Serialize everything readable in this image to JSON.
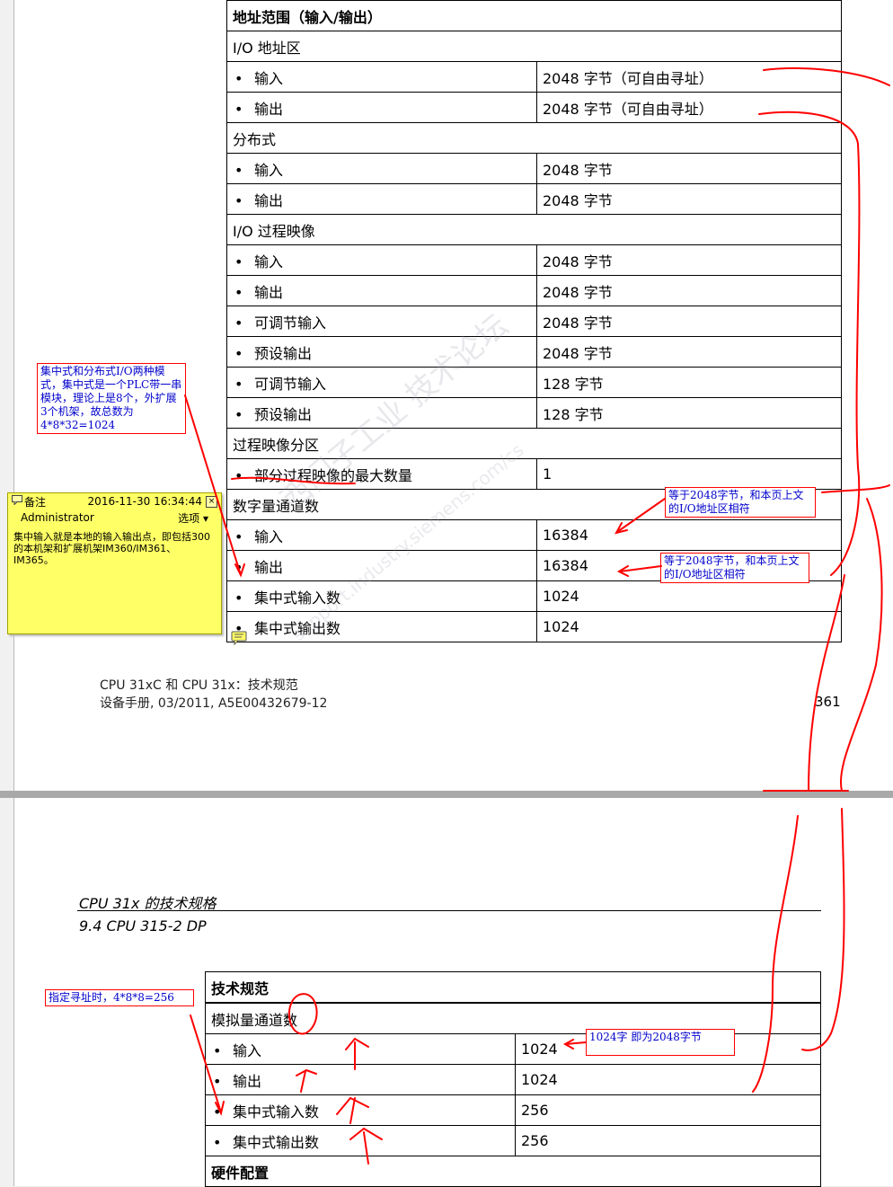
{
  "page1": {
    "table": {
      "header": "地址范围（输入/输出）",
      "rows": [
        {
          "type": "section",
          "label": "I/O 地址区"
        },
        {
          "type": "item",
          "label": "输入",
          "value": "2048 字节（可自由寻址）"
        },
        {
          "type": "item",
          "label": "输出",
          "value": "2048 字节（可自由寻址）"
        },
        {
          "type": "section",
          "label": "分布式"
        },
        {
          "type": "item",
          "label": "输入",
          "value": "2048 字节"
        },
        {
          "type": "item",
          "label": "输出",
          "value": "2048 字节"
        },
        {
          "type": "section",
          "label": "I/O 过程映像"
        },
        {
          "type": "item",
          "label": "输入",
          "value": "2048 字节"
        },
        {
          "type": "item",
          "label": "输出",
          "value": "2048 字节"
        },
        {
          "type": "item",
          "label": "可调节输入",
          "value": "2048 字节"
        },
        {
          "type": "item",
          "label": "预设输出",
          "value": "2048 字节"
        },
        {
          "type": "item",
          "label": "可调节输入",
          "value": "128 字节"
        },
        {
          "type": "item",
          "label": "预设输出",
          "value": "128 字节"
        },
        {
          "type": "section",
          "label": "过程映像分区"
        },
        {
          "type": "item",
          "label": "部分过程映像的最大数量",
          "value": "1"
        },
        {
          "type": "section",
          "label": "数字量通道数"
        },
        {
          "type": "item",
          "label": "输入",
          "value": "16384"
        },
        {
          "type": "item",
          "label": "输出",
          "value": "16384"
        },
        {
          "type": "item",
          "label": "集中式输入数",
          "value": "1024"
        },
        {
          "type": "item",
          "label": "集中式输出数",
          "value": "1024"
        }
      ]
    },
    "footer_line1": "CPU 31xC 和 CPU 31x：技术规范",
    "footer_line2": "设备手册, 03/2011, A5E00432679-12",
    "page_number": "361"
  },
  "page2": {
    "chapter": "CPU 31x 的技术规格",
    "section": "9.4 CPU 315-2 DP",
    "table": {
      "header": "技术规范",
      "rows": [
        {
          "type": "section",
          "label": "模拟量通道数"
        },
        {
          "type": "item",
          "label": "输入",
          "value": "1024"
        },
        {
          "type": "item",
          "label": "输出",
          "value": "1024"
        },
        {
          "type": "item",
          "label": "集中式输入数",
          "value": "256"
        },
        {
          "type": "item",
          "label": "集中式输出数",
          "value": "256"
        }
      ],
      "footer_header": "硬件配置"
    }
  },
  "annotations": {
    "note_left": "集中式和分布式I/O两种模式，集中式是一个PLC带一串模块，理论上是8个，外扩展3个机架，故总数为4*8*32=1024",
    "note_digital_in": "等于2048字节，和本页上文的I/O地址区相符",
    "note_digital_out": "等于2048字节，和本页上文的I/O地址区相符",
    "note_addr": "指定寻址时，4*8*8=256",
    "note_analog": "1024字   即为2048字节"
  },
  "sticky_note": {
    "title": "备注",
    "timestamp": "2016-11-30 16:34:44",
    "author": "Administrator",
    "options": "选项",
    "body": "集中输入就是本地的输入输出点，即包括300的本机架和扩展机架IM360/IM361、IM365。"
  },
  "watermark": "西门子工业 技术论坛",
  "watermark_url": "support.industry.siemens.com/cs",
  "colors": {
    "ink": "#ff0000",
    "note_text": "#0000cc",
    "sticky": "#ffff66"
  }
}
